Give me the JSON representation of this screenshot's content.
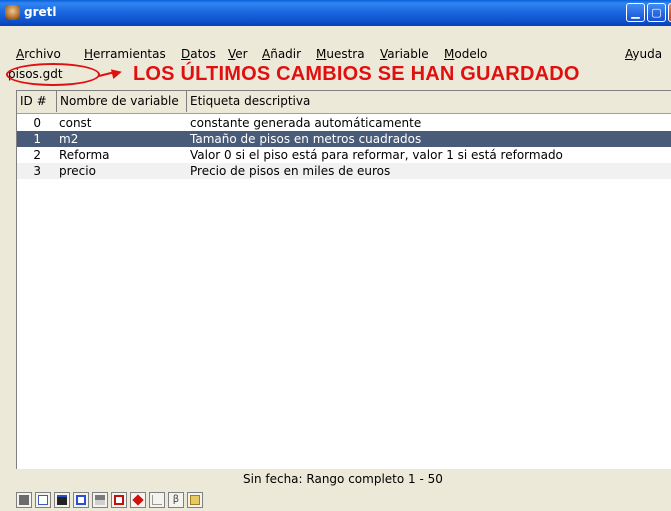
{
  "window": {
    "title": "gretl",
    "minimize_glyph": "▁",
    "maximize_glyph": "▢",
    "close_glyph": "✕"
  },
  "menu": [
    {
      "label": "Archivo",
      "mnemonic_index": 0
    },
    {
      "label": "Herramientas",
      "mnemonic_index": 0
    },
    {
      "label": "Datos",
      "mnemonic_index": 0
    },
    {
      "label": "Ver",
      "mnemonic_index": 0
    },
    {
      "label": "Añadir",
      "mnemonic_index": 0
    },
    {
      "label": "Muestra",
      "mnemonic_index": 0
    },
    {
      "label": "Variable",
      "mnemonic_index": 0
    },
    {
      "label": "Modelo",
      "mnemonic_index": 0
    },
    {
      "label": "Ayuda",
      "mnemonic_index": 0
    }
  ],
  "file": {
    "name": "pisos.gdt"
  },
  "annotation": {
    "text": "LOS ÚLTIMOS CAMBIOS SE HAN GUARDADO",
    "color": "#e01010"
  },
  "table": {
    "headers": [
      "ID #",
      "Nombre de variable",
      "Etiqueta descriptiva"
    ],
    "rows": [
      {
        "id": "0",
        "name": "const",
        "label": "constante generada automáticamente",
        "selected": false
      },
      {
        "id": "1",
        "name": "m2",
        "label": "Tamaño de pisos en metros cuadrados",
        "selected": true
      },
      {
        "id": "2",
        "name": "Reforma",
        "label": "Valor 0 si el piso está para reformar, valor 1 si está reformado",
        "selected": false
      },
      {
        "id": "3",
        "name": "precio",
        "label": "Precio de pisos en miles de euros",
        "selected": false
      }
    ]
  },
  "status": {
    "text": "Sin fecha: Rango completo 1 - 50"
  },
  "toolbar": {
    "icons": [
      "calculator-icon",
      "edit-script-icon",
      "terminal-icon",
      "session-icon",
      "data-table-icon",
      "help-pdf-icon",
      "diamond-icon",
      "graph-icon",
      "beta-icon",
      "open-folder-icon"
    ]
  },
  "colors": {
    "titlebar": "#0b4fc9",
    "selected_row": "#485c7a",
    "window_bg": "#ece9d8"
  }
}
